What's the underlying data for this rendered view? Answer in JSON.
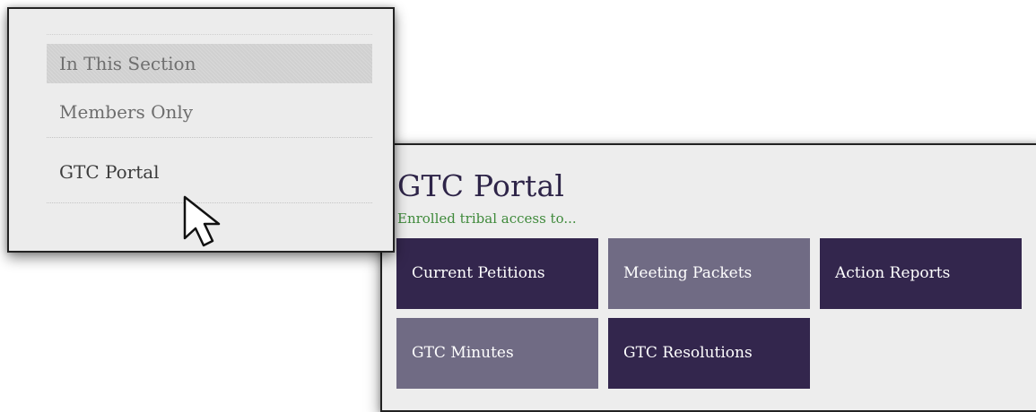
{
  "sidebar": {
    "heading": "In This Section",
    "items": [
      {
        "label": "Members Only"
      },
      {
        "label": "GTC Portal"
      }
    ]
  },
  "portal": {
    "title": "GTC Portal",
    "subtitle": "Enrolled tribal access to...",
    "tiles": [
      {
        "label": "Current Petitions",
        "color": "#33264d"
      },
      {
        "label": "Meeting Packets",
        "color": "#706b84"
      },
      {
        "label": "Action Reports",
        "color": "#33264d"
      },
      {
        "label": "GTC Minutes",
        "color": "#706b84"
      },
      {
        "label": "GTC Resolutions",
        "color": "#33264d"
      }
    ],
    "colors": {
      "title": "#2e2448",
      "subtitle": "#3f8a3b"
    }
  },
  "icons": {
    "cursor": "mouse-pointer-icon"
  }
}
